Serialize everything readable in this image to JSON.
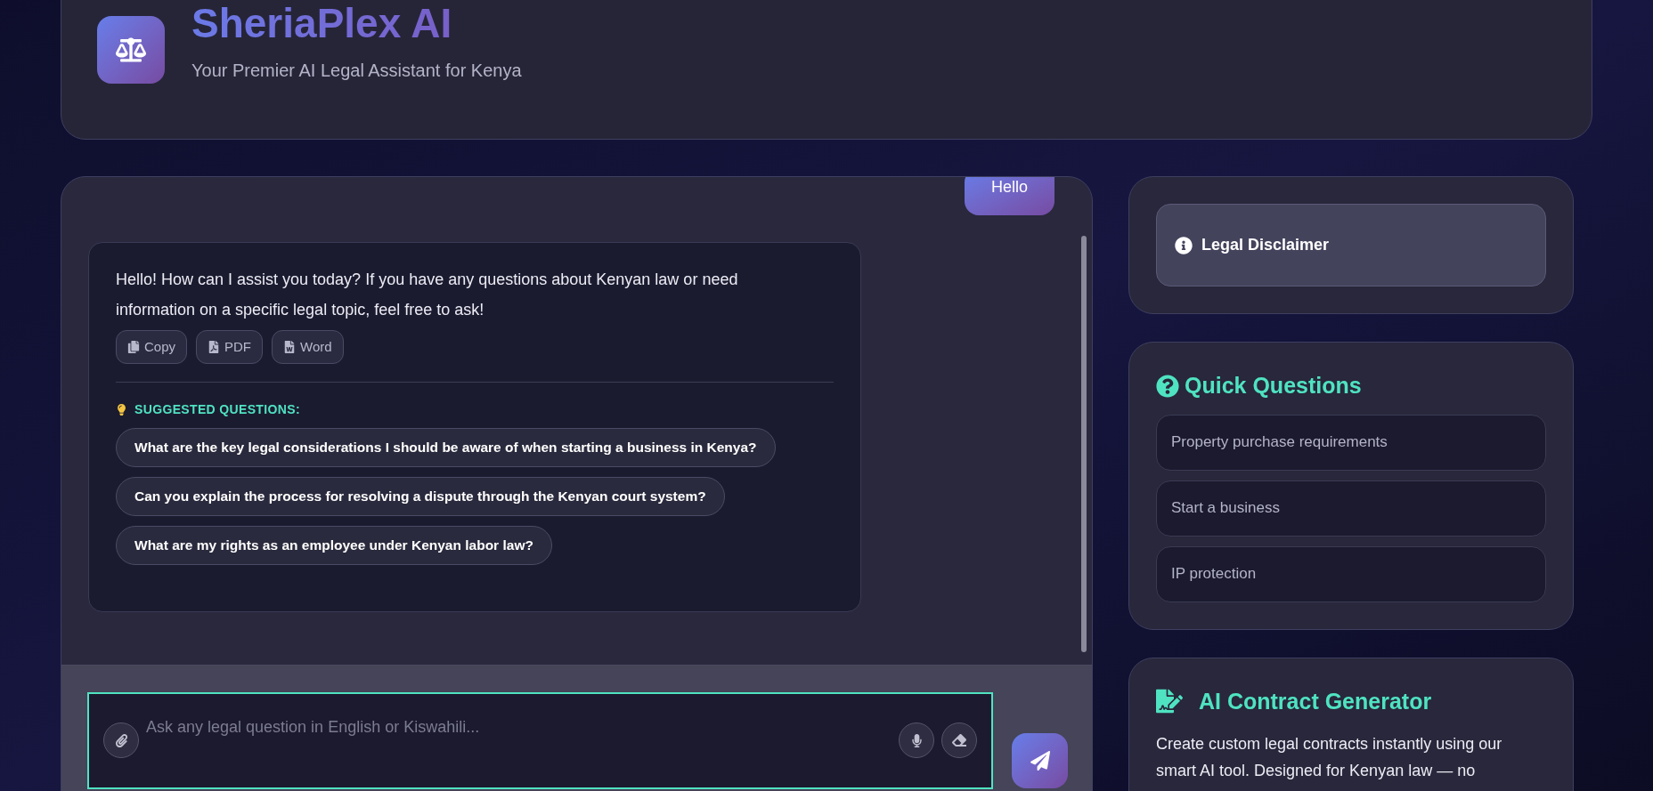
{
  "app": {
    "title": "SheriaPlex AI",
    "subtitle": "Your Premier AI Legal Assistant for Kenya"
  },
  "chat": {
    "messages": [
      {
        "kind": "user",
        "text": "Hello"
      },
      {
        "kind": "assistant",
        "text": "Hello! How can I assist you today? If you have any questions about Kenyan law or need information on a specific legal topic, feel free to ask!",
        "actions": [
          "Copy",
          "PDF",
          "Word"
        ],
        "suggested_heading": "SUGGESTED QUESTIONS:",
        "suggestions": [
          "What are the key legal considerations I should be aware of when starting a business in Kenya?",
          "Can you explain the process for resolving a dispute through the Kenyan court system?",
          "What are my rights as an employee under Kenyan labor law?"
        ]
      }
    ]
  },
  "input": {
    "placeholder": "Ask any legal question in English or Kiswahili..."
  },
  "sidebar": {
    "disclaimer": {
      "title": "Legal Disclaimer"
    },
    "quick_questions": {
      "title": "Quick Questions",
      "items": [
        "Property purchase requirements",
        "Start a business",
        "IP protection"
      ]
    },
    "contract_generator": {
      "title": "AI Contract Generator",
      "description": "Create custom legal contracts instantly using our smart AI tool. Designed for Kenyan law — no"
    }
  }
}
